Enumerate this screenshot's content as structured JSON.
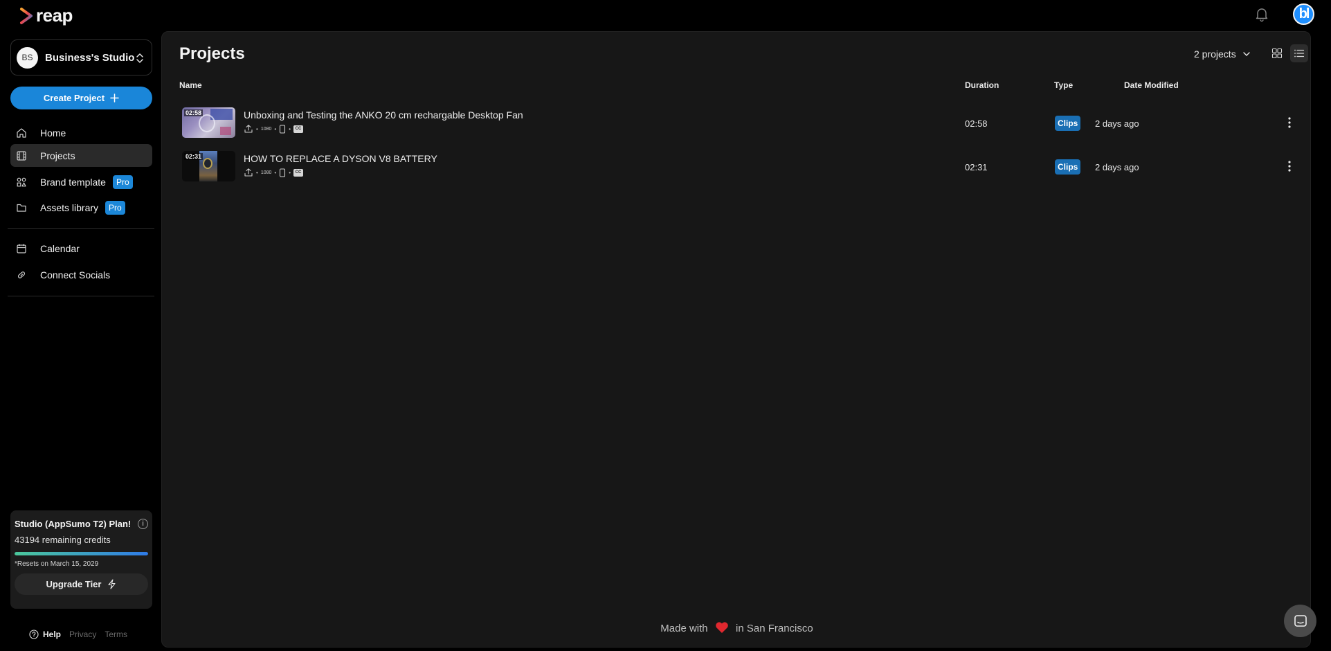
{
  "app": {
    "logo_text": "reap"
  },
  "sidebar": {
    "studio": {
      "initials": "BS",
      "name": "Business's Studio"
    },
    "create_label": "Create Project",
    "nav": [
      {
        "label": "Home",
        "icon": "home-icon"
      },
      {
        "label": "Projects",
        "icon": "film-icon",
        "active": true
      },
      {
        "label": "Brand template",
        "icon": "shapes-icon",
        "badge": "Pro"
      },
      {
        "label": "Assets library",
        "icon": "folder-icon",
        "badge": "Pro"
      },
      {
        "label": "Calendar",
        "icon": "calendar-icon"
      },
      {
        "label": "Connect Socials",
        "icon": "link-icon"
      }
    ],
    "plan": {
      "title": "Studio (AppSumo T2) Plan!",
      "credits": "43194 remaining credits",
      "progress_fraction": 1.0,
      "reset_text": "*Resets on March 15, 2029",
      "upgrade_label": "Upgrade Tier"
    },
    "footer": {
      "help": "Help",
      "privacy": "Privacy",
      "terms": "Terms"
    }
  },
  "header": {
    "avatar_text": "bl"
  },
  "main": {
    "title": "Projects",
    "count_label": "2 projects",
    "view_mode": "list",
    "columns": {
      "name": "Name",
      "duration": "Duration",
      "type": "Type",
      "date": "Date Modified"
    },
    "projects": [
      {
        "thumb_time": "02:58",
        "title": "Unboxing and Testing the ANKO 20 cm rechargable Desktop Fan",
        "resolution": "1080",
        "duration": "02:58",
        "type": "Clips",
        "date": "2 days ago"
      },
      {
        "thumb_time": "02:31",
        "title": "HOW TO REPLACE A DYSON V8 BATTERY",
        "resolution": "1080",
        "duration": "02:31",
        "type": "Clips",
        "date": "2 days ago"
      }
    ],
    "footer_prefix": "Made with",
    "footer_suffix": "in San Francisco"
  },
  "colors": {
    "accent": "#1a86d9",
    "badge": "#1a6fb4",
    "panel": "#171717",
    "background": "#000000"
  }
}
